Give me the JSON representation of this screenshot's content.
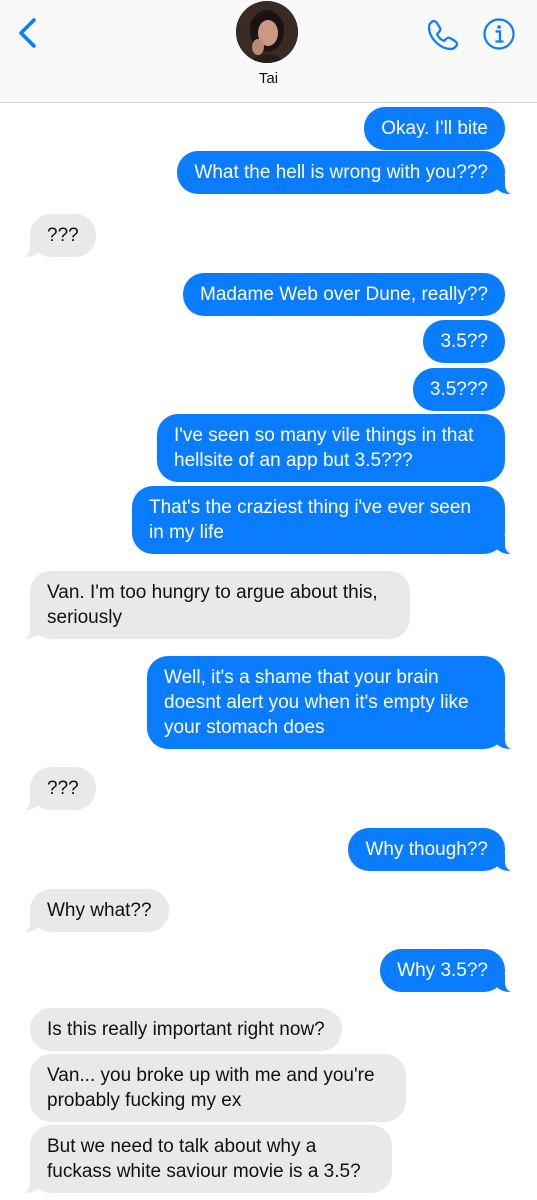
{
  "header": {
    "contact_name": "Tai",
    "back_icon": "chevron-left-icon",
    "call_icon": "phone-icon",
    "info_icon": "info-icon",
    "accent_color": "#0a7cff"
  },
  "messages": [
    {
      "direction": "outgoing",
      "text": "Okay. I'll bite"
    },
    {
      "direction": "outgoing",
      "text": "What the hell is wrong with you???"
    },
    {
      "direction": "incoming",
      "text": "???"
    },
    {
      "direction": "outgoing",
      "text": "Madame Web over Dune, really??"
    },
    {
      "direction": "outgoing",
      "text": "3.5??"
    },
    {
      "direction": "outgoing",
      "text": "3.5???"
    },
    {
      "direction": "outgoing",
      "text": "I've seen so many vile things in that hellsite of an app but 3.5???"
    },
    {
      "direction": "outgoing",
      "text": "That's the craziest thing i've ever seen in my life"
    },
    {
      "direction": "incoming",
      "text": "Van. I'm too hungry to argue about this, seriously"
    },
    {
      "direction": "outgoing",
      "text": "Well, it's a shame that your brain doesnt alert you when it's empty like your stomach does"
    },
    {
      "direction": "incoming",
      "text": "???"
    },
    {
      "direction": "outgoing",
      "text": "Why though??"
    },
    {
      "direction": "incoming",
      "text": "Why what??"
    },
    {
      "direction": "outgoing",
      "text": "Why 3.5??"
    },
    {
      "direction": "incoming",
      "text": "Is this really important right now?"
    },
    {
      "direction": "incoming",
      "text": "Van... you broke up with me and you're probably fucking my ex"
    },
    {
      "direction": "incoming",
      "text": "But we need to talk about why a fuckass white saviour movie is a 3.5?"
    }
  ]
}
